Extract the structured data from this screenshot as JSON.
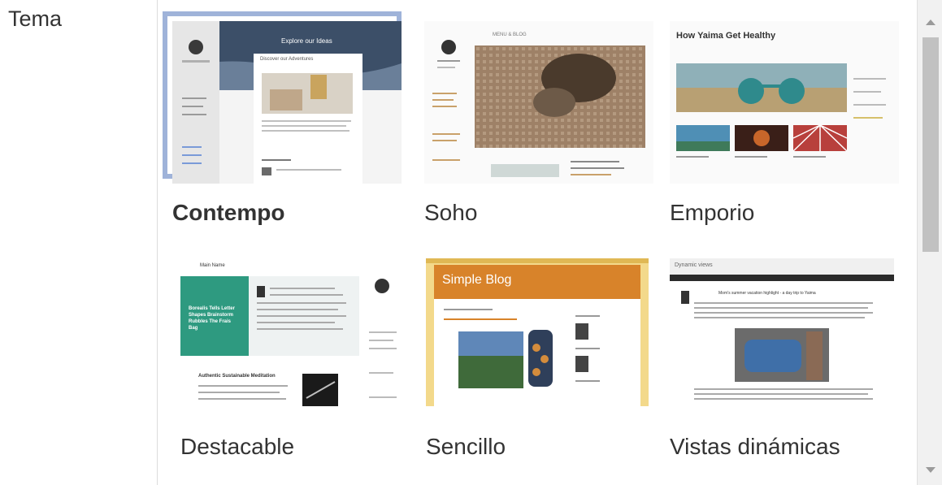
{
  "section": {
    "label": "Tema"
  },
  "themes": [
    {
      "label": "Contempo",
      "selected": true,
      "preview": {
        "header_text": "Explore our Ideas",
        "post_title": "Discover our Adventures"
      }
    },
    {
      "label": "Soho",
      "selected": false,
      "preview": {
        "nav_text": "MENU & BLOG"
      }
    },
    {
      "label": "Emporio",
      "selected": false,
      "preview": {
        "title": "How Yaima Get Healthy"
      }
    },
    {
      "label": "Destacable",
      "selected": false,
      "preview": {
        "header": "Main Name",
        "feature_text": "Borealis Tells Letter Shapes Brainstorm Rubbles The Frais Bag",
        "post_title": "Authentic Sustainable Meditation"
      }
    },
    {
      "label": "Sencillo",
      "selected": false,
      "preview": {
        "title": "Simple Blog"
      }
    },
    {
      "label": "Vistas dinámicas",
      "selected": false,
      "preview": {
        "title": "Dynamic views",
        "headline": "Mom's summer vacation highlight - a day trip to Yaima"
      }
    }
  ],
  "colors": {
    "selected_frame": "#9fb3d9",
    "contempo_dark": "#3c4f68",
    "destacable_green": "#2e9a80",
    "sencillo_orange": "#d8832a",
    "dynamic_dark": "#2b2b2b"
  }
}
